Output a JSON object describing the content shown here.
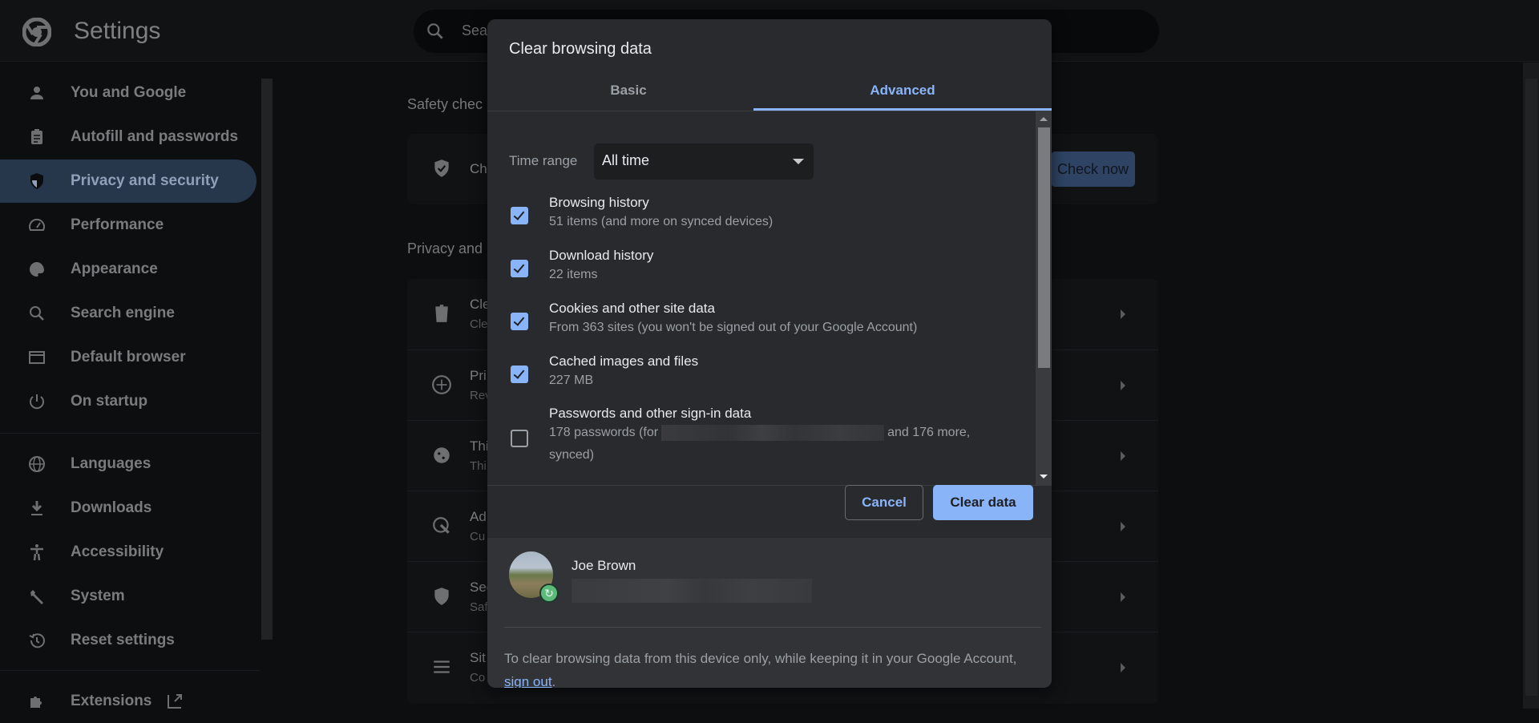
{
  "header": {
    "title": "Settings",
    "search_placeholder": "Sear"
  },
  "sidebar": {
    "items": [
      {
        "label": "You and Google",
        "icon": "person-icon"
      },
      {
        "label": "Autofill and passwords",
        "icon": "clipboard-icon"
      },
      {
        "label": "Privacy and security",
        "icon": "shield-icon",
        "active": true
      },
      {
        "label": "Performance",
        "icon": "speedometer-icon"
      },
      {
        "label": "Appearance",
        "icon": "palette-icon"
      },
      {
        "label": "Search engine",
        "icon": "search-icon"
      },
      {
        "label": "Default browser",
        "icon": "browser-icon"
      },
      {
        "label": "On startup",
        "icon": "power-icon"
      },
      {
        "label": "Languages",
        "icon": "globe-icon"
      },
      {
        "label": "Downloads",
        "icon": "download-icon"
      },
      {
        "label": "Accessibility",
        "icon": "accessibility-icon"
      },
      {
        "label": "System",
        "icon": "wrench-icon"
      },
      {
        "label": "Reset settings",
        "icon": "history-icon"
      },
      {
        "label": "Extensions",
        "icon": "puzzle-icon"
      }
    ]
  },
  "main": {
    "safety_title": "Safety chec",
    "safety_row": "Ch",
    "check_now": "Check now",
    "privacy_title": "Privacy and",
    "rows": [
      {
        "t": "Cle",
        "s": "Cle"
      },
      {
        "t": "Pri",
        "s": "Rev"
      },
      {
        "t": "Thi",
        "s": "Thi"
      },
      {
        "t": "Ad",
        "s": "Cu"
      },
      {
        "t": "Sec",
        "s": "Saf"
      },
      {
        "t": "Sit",
        "s": "Co"
      }
    ]
  },
  "dialog": {
    "title": "Clear browsing data",
    "tabs": {
      "basic": "Basic",
      "advanced": "Advanced"
    },
    "time_range_label": "Time range",
    "time_range_value": "All time",
    "items": [
      {
        "title": "Browsing history",
        "sub": "51 items (and more on synced devices)",
        "checked": true
      },
      {
        "title": "Download history",
        "sub": "22 items",
        "checked": true
      },
      {
        "title": "Cookies and other site data",
        "sub": "From 363 sites (you won't be signed out of your Google Account)",
        "checked": true
      },
      {
        "title": "Cached images and files",
        "sub": "227 MB",
        "checked": true
      },
      {
        "title": "Passwords and other sign-in data",
        "sub_a": "178 passwords (for",
        "sub_b": "and 176 more,",
        "sub_c": "synced)",
        "checked": false
      }
    ],
    "cancel": "Cancel",
    "clear": "Clear data",
    "account_name": "Joe Brown",
    "footer_text": "To clear browsing data from this device only, while keeping it in your Google Account, ",
    "footer_link": "sign out",
    "footer_end": "."
  },
  "colors": {
    "accent": "#8ab4f8",
    "dialog_bg": "#292a2d"
  }
}
